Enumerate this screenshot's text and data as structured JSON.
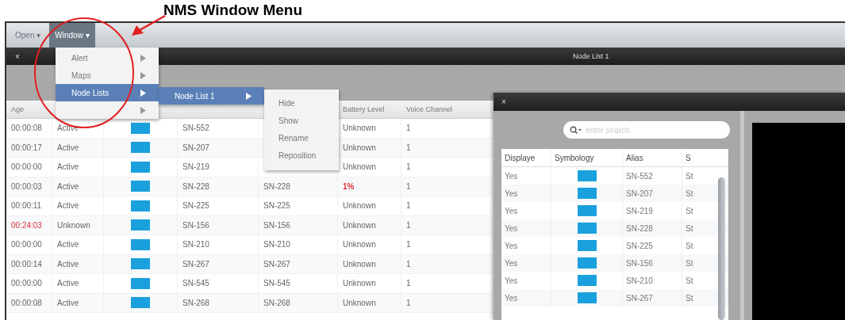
{
  "annotation": {
    "label": "NMS Window Menu"
  },
  "menu_bar": [
    {
      "label": "Open",
      "caret": "▾",
      "selected": false
    },
    {
      "label": "Window",
      "caret": "▾",
      "selected": true
    }
  ],
  "window_menu": [
    {
      "label": "Alert",
      "submenu": true,
      "selected": false
    },
    {
      "label": "Maps",
      "submenu": true,
      "selected": false
    },
    {
      "label": "Node Lists",
      "submenu": true,
      "selected": true
    },
    {
      "submenu": true,
      "selected": false
    }
  ],
  "node_lists_menu": [
    {
      "label": "Node List 1",
      "submenu": true,
      "selected": true
    }
  ],
  "node_list_actions": [
    "Hide",
    "Show",
    "Rename",
    "Reposition"
  ],
  "node_list_window": {
    "close": "×",
    "title": "Node List 1",
    "column_headers": {
      "age": "Age",
      "battery_level": "Battery Level",
      "voice_channel": "Voice Channel"
    },
    "rows": [
      {
        "age": "00:00:08",
        "age_alert": false,
        "status": "Active",
        "name": "SN-552",
        "battery": "Unknown",
        "battery_alert": false,
        "voice_channel": "1"
      },
      {
        "age": "00:00:17",
        "age_alert": false,
        "status": "Active",
        "name": "SN-207",
        "battery": "Unknown",
        "battery_alert": false,
        "voice_channel": "1"
      },
      {
        "age": "00:00:00",
        "age_alert": false,
        "status": "Active",
        "name": "SN-219",
        "battery": "Unknown",
        "battery_alert": false,
        "voice_channel": "1"
      },
      {
        "age": "00:00:03",
        "age_alert": false,
        "status": "Active",
        "name": "SN-228",
        "alias": "SN-228",
        "battery": "1%",
        "battery_alert": true,
        "voice_channel": "1"
      },
      {
        "age": "00:00:11",
        "age_alert": false,
        "status": "Active",
        "name": "SN-225",
        "alias": "SN-225",
        "battery": "Unknown",
        "battery_alert": false,
        "voice_channel": "1"
      },
      {
        "age": "00:24:03",
        "age_alert": true,
        "status": "Unknown",
        "name": "SN-156",
        "alias": "SN-156",
        "battery": "Unknown",
        "battery_alert": false,
        "voice_channel": "1"
      },
      {
        "age": "00:00:00",
        "age_alert": false,
        "status": "Active",
        "name": "SN-210",
        "alias": "SN-210",
        "battery": "Unknown",
        "battery_alert": false,
        "voice_channel": "1"
      },
      {
        "age": "00:00:14",
        "age_alert": false,
        "status": "Active",
        "name": "SN-267",
        "alias": "SN-267",
        "battery": "Unknown",
        "battery_alert": false,
        "voice_channel": "1"
      },
      {
        "age": "00:00:00",
        "age_alert": false,
        "status": "Active",
        "name": "SN-545",
        "alias": "SN-545",
        "battery": "Unknown",
        "battery_alert": false,
        "voice_channel": "1"
      },
      {
        "age": "00:00:08",
        "age_alert": false,
        "status": "Active",
        "name": "SN-268",
        "alias": "SN-268",
        "battery": "Unknown",
        "battery_alert": false,
        "voice_channel": "1"
      }
    ]
  },
  "alias_window": {
    "close": "×",
    "search": {
      "placeholder": "enter search"
    },
    "columns": [
      "Displaye",
      "Symbology",
      "Alias",
      "S"
    ],
    "rows": [
      {
        "displayed": "Yes",
        "alias": "SN-552",
        "column_4": "St"
      },
      {
        "displayed": "Yes",
        "alias": "SN-207",
        "column_4": "St"
      },
      {
        "displayed": "Yes",
        "alias": "SN-219",
        "column_4": "St"
      },
      {
        "displayed": "Yes",
        "alias": "SN-228",
        "column_4": "St"
      },
      {
        "displayed": "Yes",
        "alias": "SN-225",
        "column_4": "St"
      },
      {
        "displayed": "Yes",
        "alias": "SN-156",
        "column_4": "St"
      },
      {
        "displayed": "Yes",
        "alias": "SN-210",
        "column_4": "St"
      },
      {
        "displayed": "Yes",
        "alias": "SN-267",
        "column_4": "St"
      }
    ]
  }
}
